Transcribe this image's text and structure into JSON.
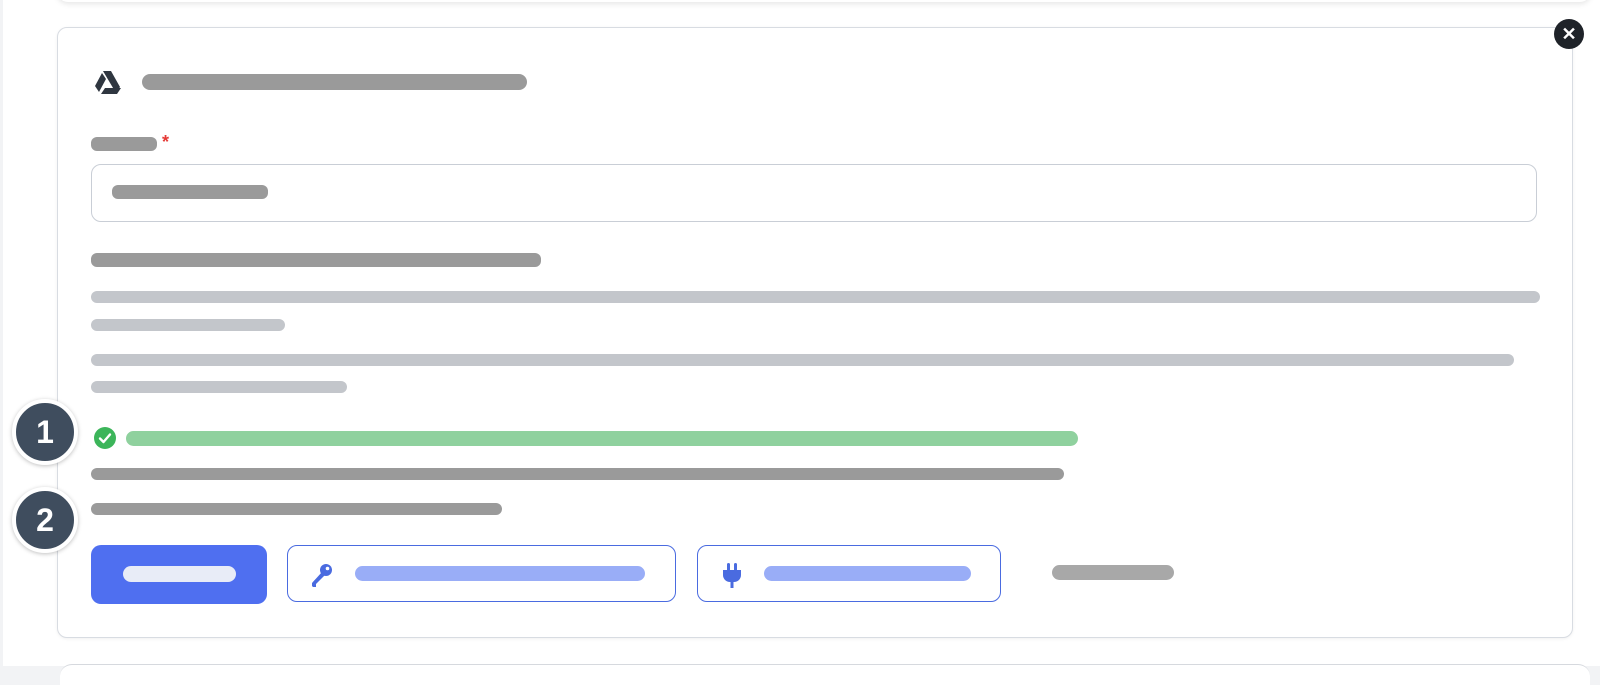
{
  "close_button": {
    "glyph": "✕",
    "icon": "close-icon"
  },
  "form": {
    "icon": "google-drive-icon",
    "required_marker": "*",
    "status_icon": "check-circle-icon",
    "colors": {
      "primary": "#4f6ff0",
      "outline": "#4a6be0",
      "success": "#3cb55a",
      "required": "#e53935"
    }
  },
  "buttons": {
    "key_icon": "key-icon",
    "plug_icon": "plug-icon"
  },
  "step_markers": [
    "1",
    "2"
  ]
}
